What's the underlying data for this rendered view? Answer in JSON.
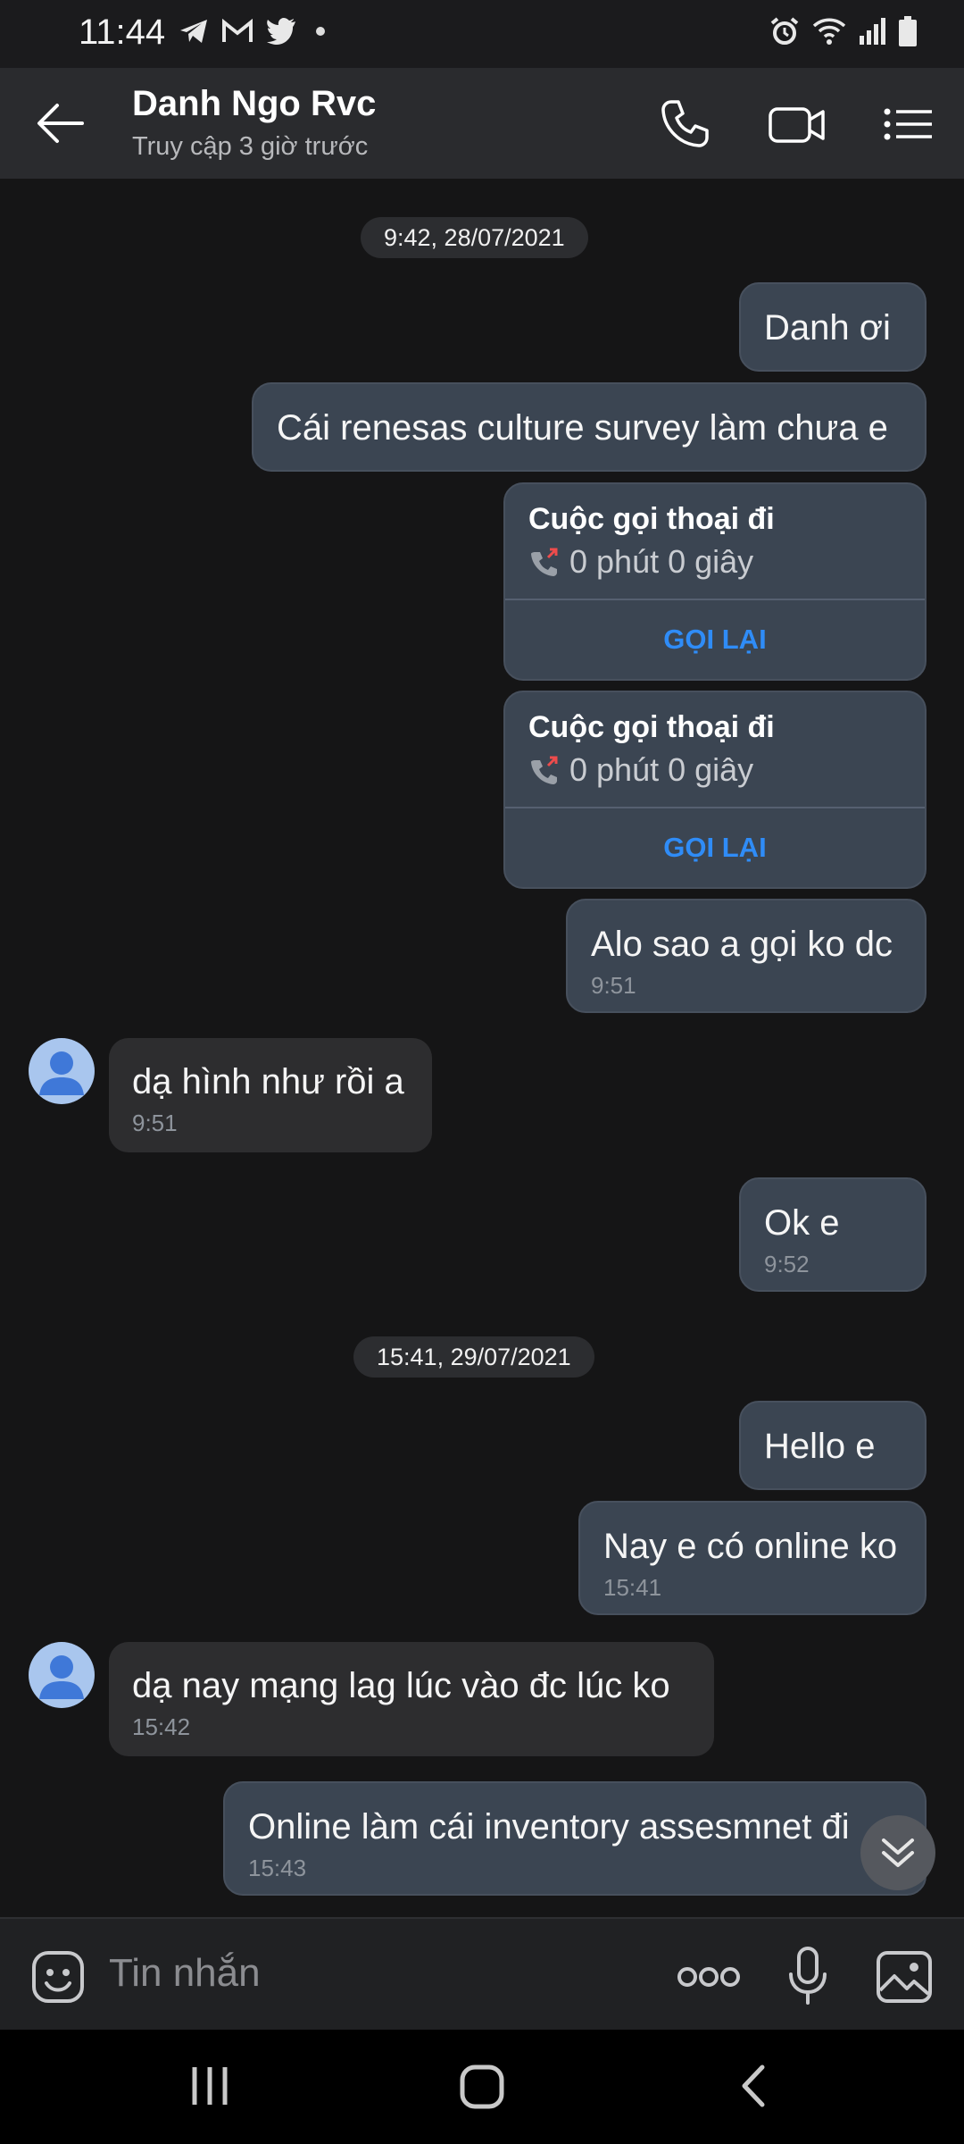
{
  "status_bar": {
    "time": "11:44",
    "left_icons": [
      "telegram-icon",
      "gmail-icon",
      "twitter-icon",
      "dot-icon"
    ],
    "right_icons": [
      "alarm-icon",
      "wifi-icon",
      "signal-icon",
      "battery-icon"
    ]
  },
  "header": {
    "contact_name": "Danh Ngo Rvc",
    "status": "Truy cập 3 giờ trước",
    "icons": [
      "back-arrow-icon",
      "phone-icon",
      "video-call-icon",
      "menu-list-icon"
    ]
  },
  "dates": {
    "d1": "9:42, 28/07/2021",
    "d2": "15:41, 29/07/2021"
  },
  "messages": {
    "m1": {
      "text": "Danh ơi",
      "direction": "out"
    },
    "m2": {
      "text": "Cái renesas culture survey làm chưa e",
      "direction": "out"
    },
    "m3": {
      "text": "Alo sao a gọi ko dc",
      "time": "9:51",
      "direction": "out"
    },
    "m4": {
      "text": "dạ hình như rồi a",
      "time": "9:51",
      "direction": "in"
    },
    "m5": {
      "text": "Ok e",
      "time": "9:52",
      "direction": "out"
    },
    "m6": {
      "text": "Hello e",
      "direction": "out"
    },
    "m7": {
      "text": "Nay e có online ko",
      "time": "15:41",
      "direction": "out"
    },
    "m8": {
      "text": "dạ nay mạng lag lúc vào đc lúc ko",
      "time": "15:42",
      "direction": "in"
    },
    "m9": {
      "text": "Online làm cái inventory assesmnet đi",
      "time": "15:43",
      "direction": "out"
    }
  },
  "calls": {
    "c1": {
      "title": "Cuộc gọi thoại đi",
      "detail": "0 phút 0 giây",
      "action": "GỌI LẠI"
    },
    "c2": {
      "title": "Cuộc gọi thoại đi",
      "detail": "0 phút 0 giây",
      "action": "GỌI LẠI"
    }
  },
  "input": {
    "placeholder": "Tin nhắn",
    "icons": [
      "sticker-icon",
      "more-options-icon",
      "microphone-icon",
      "gallery-icon"
    ]
  },
  "colors": {
    "background": "#151516",
    "header": "#2a2b2e",
    "outgoing_bubble": "#3b4552",
    "incoming_bubble": "#2d2d2f",
    "accent": "#2f8cf7"
  }
}
